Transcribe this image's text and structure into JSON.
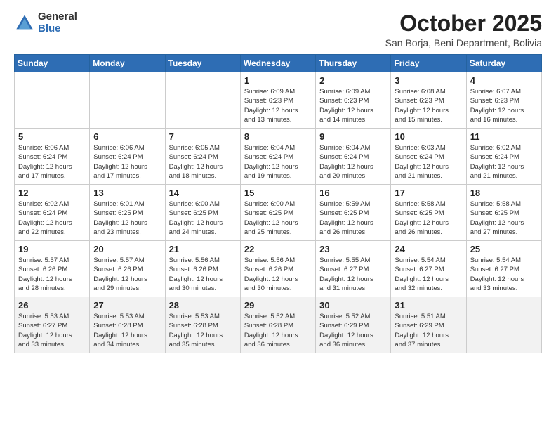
{
  "logo": {
    "general": "General",
    "blue": "Blue"
  },
  "title": "October 2025",
  "subtitle": "San Borja, Beni Department, Bolivia",
  "days_of_week": [
    "Sunday",
    "Monday",
    "Tuesday",
    "Wednesday",
    "Thursday",
    "Friday",
    "Saturday"
  ],
  "weeks": [
    [
      {
        "day": "",
        "info": ""
      },
      {
        "day": "",
        "info": ""
      },
      {
        "day": "",
        "info": ""
      },
      {
        "day": "1",
        "info": "Sunrise: 6:09 AM\nSunset: 6:23 PM\nDaylight: 12 hours\nand 13 minutes."
      },
      {
        "day": "2",
        "info": "Sunrise: 6:09 AM\nSunset: 6:23 PM\nDaylight: 12 hours\nand 14 minutes."
      },
      {
        "day": "3",
        "info": "Sunrise: 6:08 AM\nSunset: 6:23 PM\nDaylight: 12 hours\nand 15 minutes."
      },
      {
        "day": "4",
        "info": "Sunrise: 6:07 AM\nSunset: 6:23 PM\nDaylight: 12 hours\nand 16 minutes."
      }
    ],
    [
      {
        "day": "5",
        "info": "Sunrise: 6:06 AM\nSunset: 6:24 PM\nDaylight: 12 hours\nand 17 minutes."
      },
      {
        "day": "6",
        "info": "Sunrise: 6:06 AM\nSunset: 6:24 PM\nDaylight: 12 hours\nand 17 minutes."
      },
      {
        "day": "7",
        "info": "Sunrise: 6:05 AM\nSunset: 6:24 PM\nDaylight: 12 hours\nand 18 minutes."
      },
      {
        "day": "8",
        "info": "Sunrise: 6:04 AM\nSunset: 6:24 PM\nDaylight: 12 hours\nand 19 minutes."
      },
      {
        "day": "9",
        "info": "Sunrise: 6:04 AM\nSunset: 6:24 PM\nDaylight: 12 hours\nand 20 minutes."
      },
      {
        "day": "10",
        "info": "Sunrise: 6:03 AM\nSunset: 6:24 PM\nDaylight: 12 hours\nand 21 minutes."
      },
      {
        "day": "11",
        "info": "Sunrise: 6:02 AM\nSunset: 6:24 PM\nDaylight: 12 hours\nand 21 minutes."
      }
    ],
    [
      {
        "day": "12",
        "info": "Sunrise: 6:02 AM\nSunset: 6:24 PM\nDaylight: 12 hours\nand 22 minutes."
      },
      {
        "day": "13",
        "info": "Sunrise: 6:01 AM\nSunset: 6:25 PM\nDaylight: 12 hours\nand 23 minutes."
      },
      {
        "day": "14",
        "info": "Sunrise: 6:00 AM\nSunset: 6:25 PM\nDaylight: 12 hours\nand 24 minutes."
      },
      {
        "day": "15",
        "info": "Sunrise: 6:00 AM\nSunset: 6:25 PM\nDaylight: 12 hours\nand 25 minutes."
      },
      {
        "day": "16",
        "info": "Sunrise: 5:59 AM\nSunset: 6:25 PM\nDaylight: 12 hours\nand 26 minutes."
      },
      {
        "day": "17",
        "info": "Sunrise: 5:58 AM\nSunset: 6:25 PM\nDaylight: 12 hours\nand 26 minutes."
      },
      {
        "day": "18",
        "info": "Sunrise: 5:58 AM\nSunset: 6:25 PM\nDaylight: 12 hours\nand 27 minutes."
      }
    ],
    [
      {
        "day": "19",
        "info": "Sunrise: 5:57 AM\nSunset: 6:26 PM\nDaylight: 12 hours\nand 28 minutes."
      },
      {
        "day": "20",
        "info": "Sunrise: 5:57 AM\nSunset: 6:26 PM\nDaylight: 12 hours\nand 29 minutes."
      },
      {
        "day": "21",
        "info": "Sunrise: 5:56 AM\nSunset: 6:26 PM\nDaylight: 12 hours\nand 30 minutes."
      },
      {
        "day": "22",
        "info": "Sunrise: 5:56 AM\nSunset: 6:26 PM\nDaylight: 12 hours\nand 30 minutes."
      },
      {
        "day": "23",
        "info": "Sunrise: 5:55 AM\nSunset: 6:27 PM\nDaylight: 12 hours\nand 31 minutes."
      },
      {
        "day": "24",
        "info": "Sunrise: 5:54 AM\nSunset: 6:27 PM\nDaylight: 12 hours\nand 32 minutes."
      },
      {
        "day": "25",
        "info": "Sunrise: 5:54 AM\nSunset: 6:27 PM\nDaylight: 12 hours\nand 33 minutes."
      }
    ],
    [
      {
        "day": "26",
        "info": "Sunrise: 5:53 AM\nSunset: 6:27 PM\nDaylight: 12 hours\nand 33 minutes."
      },
      {
        "day": "27",
        "info": "Sunrise: 5:53 AM\nSunset: 6:28 PM\nDaylight: 12 hours\nand 34 minutes."
      },
      {
        "day": "28",
        "info": "Sunrise: 5:53 AM\nSunset: 6:28 PM\nDaylight: 12 hours\nand 35 minutes."
      },
      {
        "day": "29",
        "info": "Sunrise: 5:52 AM\nSunset: 6:28 PM\nDaylight: 12 hours\nand 36 minutes."
      },
      {
        "day": "30",
        "info": "Sunrise: 5:52 AM\nSunset: 6:29 PM\nDaylight: 12 hours\nand 36 minutes."
      },
      {
        "day": "31",
        "info": "Sunrise: 5:51 AM\nSunset: 6:29 PM\nDaylight: 12 hours\nand 37 minutes."
      },
      {
        "day": "",
        "info": ""
      }
    ]
  ]
}
